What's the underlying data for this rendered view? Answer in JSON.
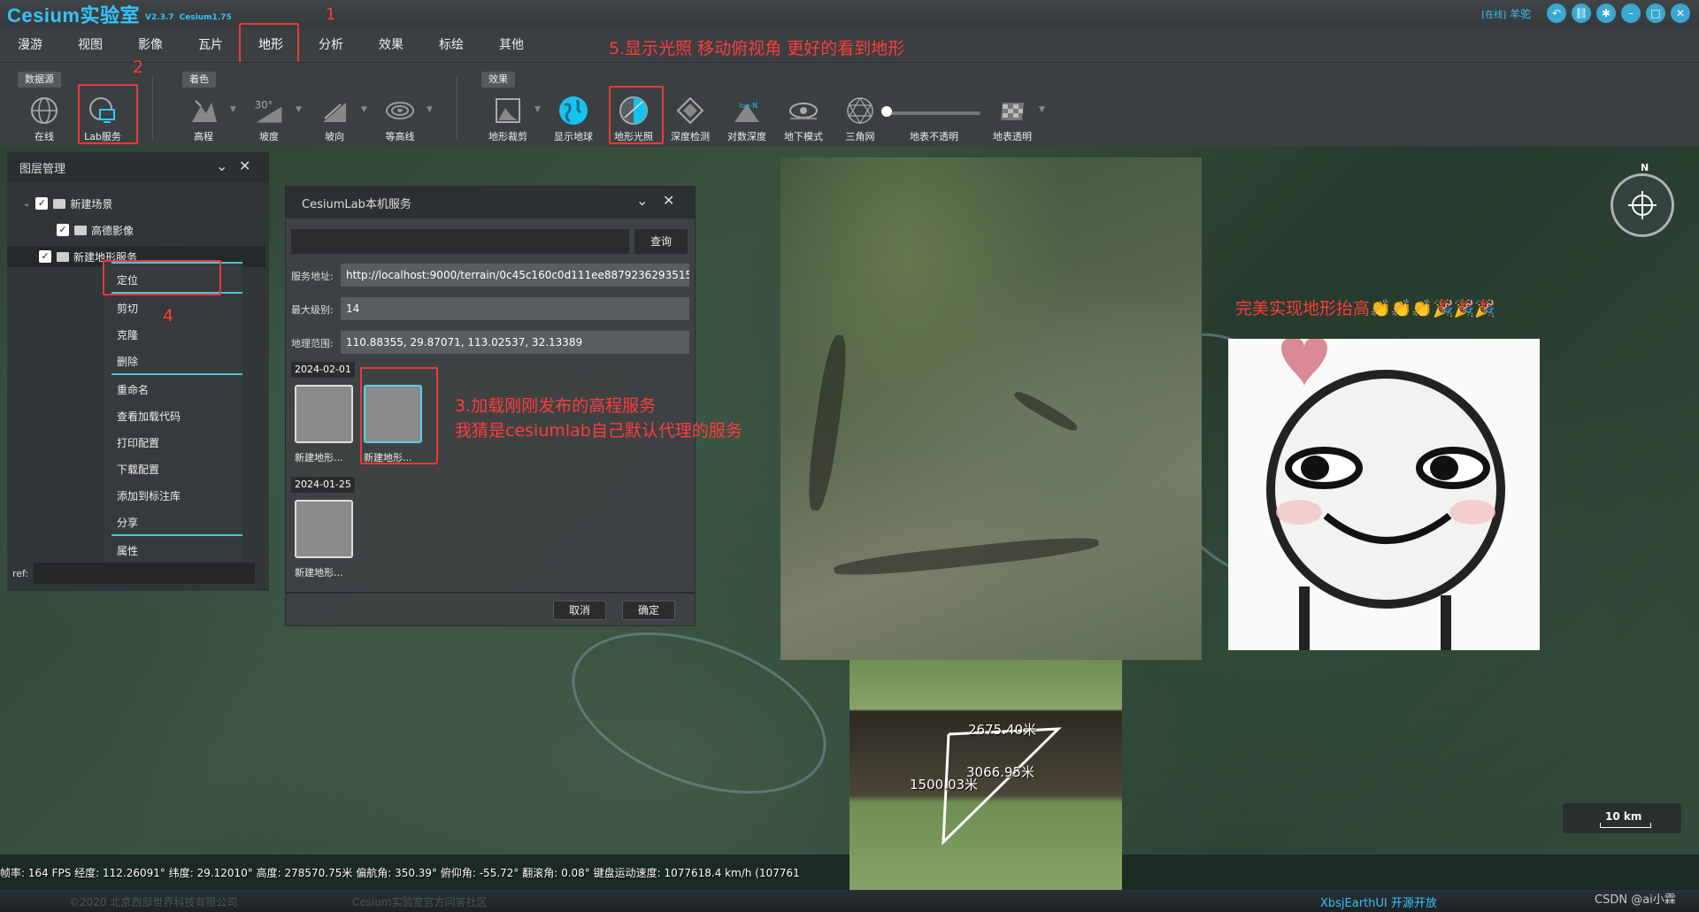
{
  "titlebar": {
    "app_name": "Cesium实验室",
    "version": "V2.3.7",
    "cesium_version": "Cesium1.75",
    "user_status": "[在线]",
    "user_name": "羊驼"
  },
  "menu": {
    "items": [
      "漫游",
      "视图",
      "影像",
      "瓦片",
      "地形",
      "分析",
      "效果",
      "标绘",
      "其他"
    ],
    "active": "地形"
  },
  "annotations": {
    "n1": "1",
    "n2": "2",
    "n4": "4",
    "step5": "5.显示光照 移动俯视角 更好的看到地形",
    "step3_line1": "3.加载刚刚发布的高程服务",
    "step3_line2": "我猜是cesiumlab自己默认代理的服务",
    "result": "完美实现地形抬高👏👏👏🎉🎉🎉"
  },
  "ribbon": {
    "groups": {
      "datasource": "数据源",
      "coloring": "着色",
      "effects": "效果"
    },
    "tools": {
      "online": "在线",
      "lab_service": "Lab服务",
      "elevation": "高程",
      "slope": "坡度",
      "aspect": "坡向",
      "contour": "等高线",
      "terrain_clip": "地形裁剪",
      "show_globe": "显示地球",
      "terrain_lighting": "地形光照",
      "depth_test": "深度检测",
      "log_depth": "对数深度",
      "underground": "地下模式",
      "triangle_mesh": "三角网",
      "surface_opaque": "地表不透明",
      "surface_transparent": "地表透明"
    },
    "slope_icon_text": "30°",
    "log_icon_text": "log-N",
    "opacity_value": 0
  },
  "layer_panel": {
    "title": "图层管理",
    "tree": [
      {
        "label": "新建场景",
        "checked": true
      },
      {
        "label": "高德影像",
        "checked": true
      },
      {
        "label": "新建地形服务",
        "checked": true
      }
    ],
    "ref_label": "ref:"
  },
  "context_menu": {
    "items": [
      "定位",
      "剪切",
      "克隆",
      "删除",
      "重命名",
      "查看加载代码",
      "打印配置",
      "下载配置",
      "添加到标注库",
      "分享",
      "属性"
    ]
  },
  "dialog": {
    "title": "CesiumLab本机服务",
    "search_placeholder": "",
    "query_button": "查询",
    "fields": {
      "url_label": "服务地址:",
      "url_value": "http://localhost:9000/terrain/0c45c160c0d111ee8879236293515",
      "maxlevel_label": "最大级别:",
      "maxlevel_value": "14",
      "range_label": "地理范围:",
      "range_value": "110.88355, 29.87071, 113.02537, 32.13389"
    },
    "groups": [
      {
        "date": "2024-02-01",
        "items": [
          "新建地形...",
          "新建地形..."
        ]
      },
      {
        "date": "2024-01-25",
        "items": [
          "新建地形..."
        ]
      }
    ],
    "cancel": "取消",
    "ok": "确定"
  },
  "measure": {
    "d1": "2675.40米",
    "d2": "3066.95米",
    "d3": "1500.03米"
  },
  "map": {
    "compass_n": "N",
    "scale": "10 km"
  },
  "status": "帧率: 164 FPS 经度: 112.26091° 纬度: 29.12010° 高度: 278570.75米 偏航角: 350.39° 俯仰角: -55.72° 翻滚角: 0.08° 键盘运动速度: 1077618.4 km/h (107761",
  "footer": {
    "copyright": "©2020 北京西部世界科技有限公司",
    "community": "Cesium实验室官方问答社区",
    "brand": "XbsjEarthUI 开源开放",
    "watermark": "CSDN @ai小霖"
  },
  "colors": {
    "accent": "#35c4ff",
    "annotation_red": "#ff3b3b",
    "selection_cyan": "#4fd3e4"
  }
}
